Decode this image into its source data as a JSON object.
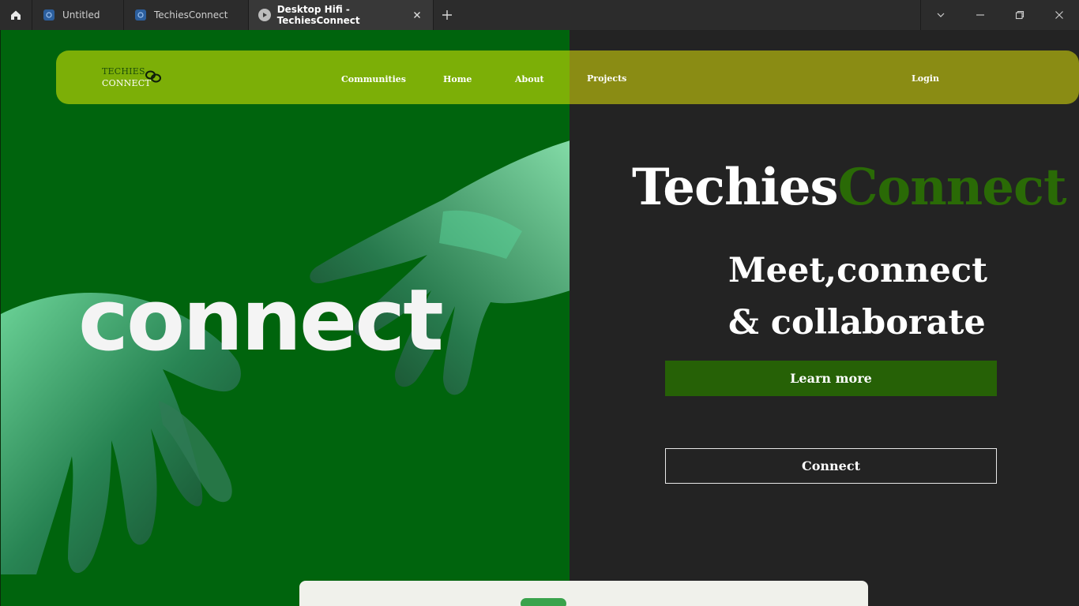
{
  "browser": {
    "tabs": [
      {
        "label": "Untitled"
      },
      {
        "label": "TechiesConnect"
      },
      {
        "label": "Desktop Hifi - TechiesConnect",
        "active": true
      }
    ],
    "icons": [
      "home-icon",
      "new-tab-icon",
      "tab-list-icon",
      "minimize-icon",
      "restore-icon",
      "close-icon"
    ]
  },
  "nav": {
    "logo_line1": "TECHIES",
    "logo_line2": "CONNECT",
    "links": [
      "Communities",
      "Home",
      "About",
      "Projects"
    ],
    "login": "Login"
  },
  "hero": {
    "image_word": "connect",
    "title_part1": "Techies",
    "title_part2": "Connect",
    "tagline_line1": "Meet,connect",
    "tagline_line2": "& collaborate",
    "learn_more": "Learn more",
    "connect": "Connect"
  },
  "colors": {
    "hero_green": "#00640d",
    "navbar_left": "#7caf07",
    "navbar_right": "#8a8c14",
    "accent_dark_green": "#266106",
    "title_green": "#2a6a06",
    "page_dark": "#232323"
  }
}
